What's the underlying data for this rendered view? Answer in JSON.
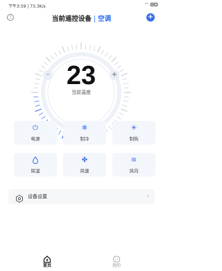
{
  "status_bar": {
    "time_speed": "下午3:59 | 73.3K/s",
    "battery": "battery-icon",
    "wifi": "wifi-icon"
  },
  "header": {
    "title": "当前遥控设备",
    "separator": "|",
    "mode": "空调",
    "info_icon": "info-icon",
    "add_icon": "plus-icon",
    "add_symbol": "+",
    "info_symbol": "!"
  },
  "dial": {
    "temperature": "23",
    "label": "当前温度",
    "decrease_symbol": "-",
    "increase_symbol": "+"
  },
  "controls": [
    {
      "label": "电源",
      "icon": "power-icon",
      "glyph": "⏻"
    },
    {
      "label": "制冷",
      "icon": "snowflake-icon",
      "glyph": "❄"
    },
    {
      "label": "制热",
      "icon": "sun-icon",
      "glyph": "☀"
    },
    {
      "label": "除湿",
      "icon": "droplet-icon",
      "glyph": "💧"
    },
    {
      "label": "风速",
      "icon": "fan-icon",
      "glyph": "✤"
    },
    {
      "label": "风向",
      "icon": "wind-icon",
      "glyph": "≋"
    }
  ],
  "settings": {
    "label": "设备设置",
    "icon": "settings-icon",
    "chevron": "›"
  },
  "tabbar": {
    "home_label": "首页",
    "mine_label": "我的"
  },
  "colors": {
    "accent": "#3a6de8",
    "tile_bg": "#f3f6fb",
    "text": "#333333"
  }
}
